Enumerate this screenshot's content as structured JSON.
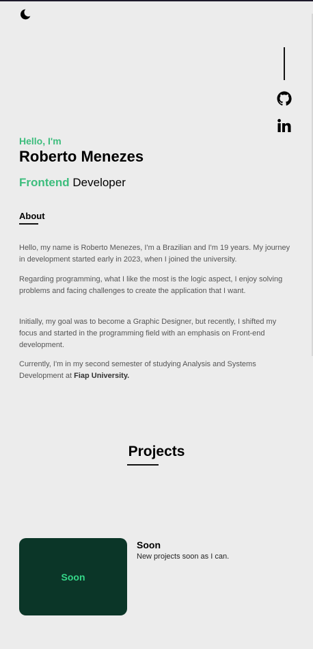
{
  "header": {
    "theme_toggle_icon": "moon-icon"
  },
  "social": {
    "github_icon": "github-icon",
    "linkedin_icon": "linkedin-icon"
  },
  "hero": {
    "greeting": "Hello, I'm",
    "name": "Roberto Menezes",
    "role_accent": "Frontend",
    "role_rest": " Developer"
  },
  "about": {
    "title": "About",
    "paragraphs": [
      "Hello, my name is Roberto Menezes, I'm a Brazilian and I'm 19 years. My journey in development started early in 2023, when I joined the university.",
      "Regarding programming, what I like the most is the logic aspect, I enjoy solving problems and facing challenges to create the application that I want.",
      "Initially, my goal was to become a Graphic Designer, but recently, I shifted my focus and started in the programming field with an emphasis on Front-end development."
    ],
    "last_paragraph_text": "Currently, I'm in my second semester of studying Analysis and Systems Development at ",
    "last_paragraph_bold": "Fiap University."
  },
  "projects": {
    "title": "Projects",
    "items": [
      {
        "thumb_label": "Soon",
        "title": "Soon",
        "description": "New projects soon as I can."
      }
    ]
  },
  "colors": {
    "accent": "#3dbd7d",
    "card_bg": "#0b3628",
    "card_text": "#35d889",
    "page_bg": "#ececec"
  }
}
